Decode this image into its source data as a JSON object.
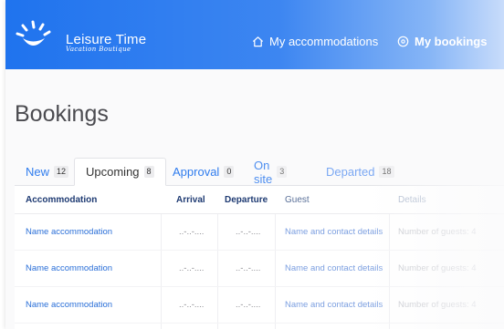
{
  "header": {
    "brand_name": "Leisure Time",
    "brand_tagline": "Vacation Boutique",
    "nav": [
      {
        "label": "My accommodations",
        "icon": "home-icon"
      },
      {
        "label": "My bookings",
        "icon": "circle-dot-icon"
      }
    ]
  },
  "page_title": "Bookings",
  "tabs": [
    {
      "label": "New",
      "count": "12"
    },
    {
      "label": "Upcoming",
      "count": "8"
    },
    {
      "label": "Approval",
      "count": "0"
    },
    {
      "label": "On site",
      "count": "3"
    },
    {
      "label": "Departed",
      "count": "18"
    }
  ],
  "table": {
    "columns": [
      "Accommodation",
      "Arrival",
      "Departure",
      "Guest",
      "Details"
    ],
    "rows": [
      {
        "accommodation": "Name accommodation",
        "arrival": "..-..-....",
        "departure": "..-..-....",
        "guest": "Name and contact details",
        "details_label": "Number of guests:",
        "details_value": "4"
      },
      {
        "accommodation": "Name accommodation",
        "arrival": "..-..-....",
        "departure": "..-..-....",
        "guest": "Name and contact details",
        "details_label": "Number of guests:",
        "details_value": "4"
      },
      {
        "accommodation": "Name accommodation",
        "arrival": "..-..-....",
        "departure": "..-..-....",
        "guest": "Name and contact details",
        "details_label": "Number of guests:",
        "details_value": "4"
      }
    ]
  },
  "colors": {
    "header_blue": "#1f73ee",
    "link_blue": "#2a6fd8",
    "heading_navy": "#1f3b73"
  }
}
